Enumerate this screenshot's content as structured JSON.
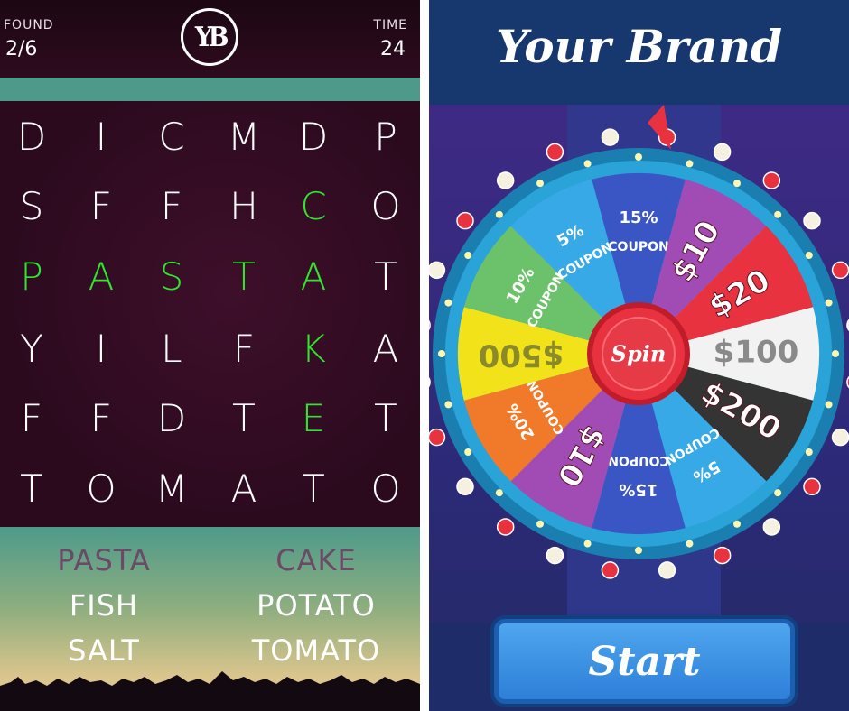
{
  "word_search": {
    "found_label": "FOUND",
    "found_value": "2/6",
    "logo_text": "YB",
    "time_label": "TIME",
    "time_value": "24",
    "grid": [
      [
        "D",
        "I",
        "C",
        "M",
        "D",
        "P"
      ],
      [
        "S",
        "F",
        "F",
        "H",
        "C",
        "O"
      ],
      [
        "P",
        "A",
        "S",
        "T",
        "A",
        "T"
      ],
      [
        "Y",
        "I",
        "L",
        "F",
        "K",
        "A"
      ],
      [
        "F",
        "F",
        "D",
        "T",
        "E",
        "T"
      ],
      [
        "T",
        "O",
        "M",
        "A",
        "T",
        "O"
      ]
    ],
    "highlight_color": "#2ee62e",
    "words": [
      {
        "text": "PASTA",
        "found": true
      },
      {
        "text": "CAKE",
        "found": true
      },
      {
        "text": "FISH",
        "found": false
      },
      {
        "text": "POTATO",
        "found": false
      },
      {
        "text": "SALT",
        "found": false
      },
      {
        "text": "TOMATO",
        "found": false
      }
    ]
  },
  "wheel": {
    "brand_title": "Your Brand",
    "center_label": "Spin",
    "start_label": "Start",
    "segments": [
      {
        "label": "COUPON",
        "sub": "15%",
        "color": "#3a55c4"
      },
      {
        "label": "$10",
        "sub": "",
        "color": "#a14bb5"
      },
      {
        "label": "$20",
        "sub": "",
        "color": "#e8323f"
      },
      {
        "label": "$100",
        "sub": "",
        "color": "#f2f2f2"
      },
      {
        "label": "$200",
        "sub": "",
        "color": "#343434"
      },
      {
        "label": "COUPON",
        "sub": "5%",
        "color": "#36a9e6"
      },
      {
        "label": "COUPON",
        "sub": "15%",
        "color": "#3a55c4"
      },
      {
        "label": "$10",
        "sub": "",
        "color": "#a14bb5"
      },
      {
        "label": "COUPON",
        "sub": "20%",
        "color": "#f07a2a"
      },
      {
        "label": "$500",
        "sub": "",
        "color": "#f2e21a"
      },
      {
        "label": "COUPON",
        "sub": "10%",
        "color": "#6cc26a"
      },
      {
        "label": "COUPON",
        "sub": "5%",
        "color": "#36a9e6"
      }
    ]
  }
}
